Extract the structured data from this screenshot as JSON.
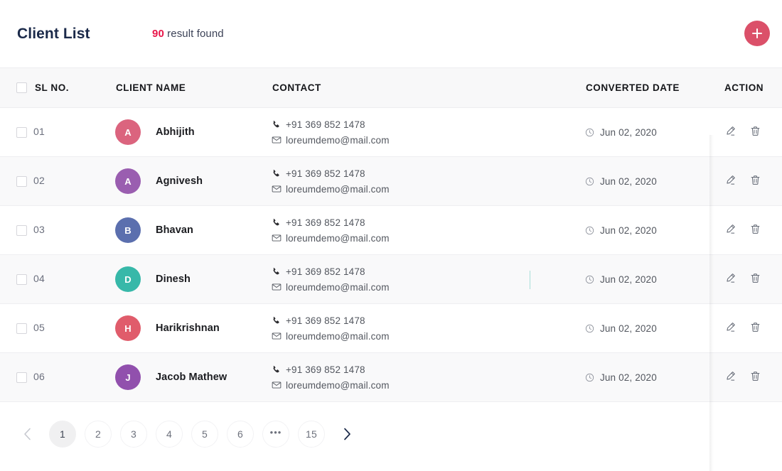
{
  "header": {
    "title": "Client List",
    "result_count": "90",
    "result_label": " result found",
    "add_button_label": "+",
    "add_button_color": "#db5069",
    "count_color": "#e8174a"
  },
  "table": {
    "columns": {
      "sl_no": "SL NO.",
      "client_name": "CLIENT NAME",
      "contact": "CONTACT",
      "converted_date": "CONVERTED DATE",
      "action": "ACTION"
    },
    "rows": [
      {
        "sl_no": "01",
        "initial": "A",
        "avatar_color": "#db647e",
        "name": "Abhijith",
        "phone": "+91 369 852 1478",
        "email": "loreumdemo@mail.com",
        "date": "Jun 02, 2020"
      },
      {
        "sl_no": "02",
        "initial": "A",
        "avatar_color": "#9a5eb0",
        "name": "Agnivesh",
        "phone": "+91 369 852 1478",
        "email": "loreumdemo@mail.com",
        "date": "Jun 02, 2020"
      },
      {
        "sl_no": "03",
        "initial": "B",
        "avatar_color": "#5b6fae",
        "name": "Bhavan",
        "phone": "+91 369 852 1478",
        "email": "loreumdemo@mail.com",
        "date": "Jun 02, 2020"
      },
      {
        "sl_no": "04",
        "initial": "D",
        "avatar_color": "#37b8a9",
        "name": "Dinesh",
        "phone": "+91 369 852 1478",
        "email": "loreumdemo@mail.com",
        "date": "Jun 02, 2020"
      },
      {
        "sl_no": "05",
        "initial": "H",
        "avatar_color": "#e05c6b",
        "name": "Harikrishnan",
        "phone": "+91 369 852 1478",
        "email": "loreumdemo@mail.com",
        "date": "Jun 02, 2020"
      },
      {
        "sl_no": "06",
        "initial": "J",
        "avatar_color": "#9150ad",
        "name": "Jacob Mathew",
        "phone": "+91 369 852 1478",
        "email": "loreumdemo@mail.com",
        "date": "Jun 02, 2020"
      }
    ],
    "row_actions": {
      "edit": "edit",
      "delete": "delete"
    }
  },
  "pagination": {
    "prev": "‹",
    "next": "›",
    "items": [
      "1",
      "2",
      "3",
      "4",
      "5",
      "6",
      "•••",
      "15"
    ],
    "active_index": 0
  }
}
